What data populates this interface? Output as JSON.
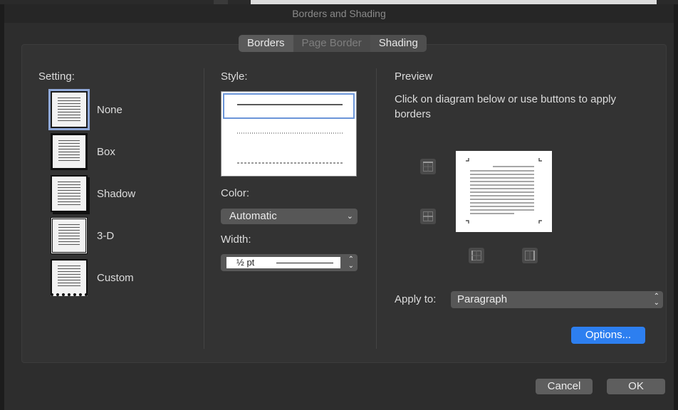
{
  "window": {
    "title": "Borders and Shading"
  },
  "tabs": [
    {
      "label": "Borders",
      "state": "active"
    },
    {
      "label": "Page Border",
      "state": "disabled"
    },
    {
      "label": "Shading",
      "state": "normal"
    }
  ],
  "setting": {
    "heading": "Setting:",
    "items": [
      {
        "label": "None",
        "icon": "border-none-icon",
        "selected": true
      },
      {
        "label": "Box",
        "icon": "border-box-icon"
      },
      {
        "label": "Shadow",
        "icon": "border-shadow-icon"
      },
      {
        "label": "3-D",
        "icon": "border-3d-icon"
      },
      {
        "label": "Custom",
        "icon": "border-custom-icon"
      }
    ]
  },
  "style": {
    "heading": "Style:",
    "options": [
      "solid",
      "dotted",
      "dashed"
    ],
    "selected": "solid"
  },
  "color": {
    "heading": "Color:",
    "value": "Automatic"
  },
  "width": {
    "heading": "Width:",
    "value": "½ pt"
  },
  "preview": {
    "heading": "Preview",
    "instructions": "Click on diagram below or use buttons to apply borders"
  },
  "apply_to": {
    "label": "Apply to:",
    "value": "Paragraph"
  },
  "buttons": {
    "options": "Options...",
    "cancel": "Cancel",
    "ok": "OK"
  },
  "colors": {
    "accent": "#2d7ff0",
    "selection": "#6b95d8"
  }
}
